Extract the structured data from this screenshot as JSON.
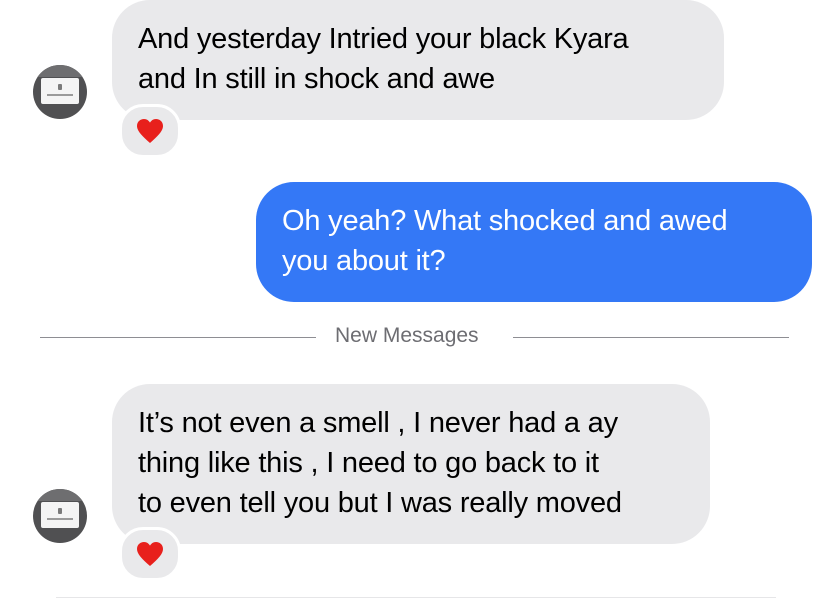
{
  "conversation": {
    "messages": [
      {
        "direction": "incoming",
        "lines": [
          "And yesterday Intried your black Kyara",
          "and In still in shock and awe"
        ],
        "reaction": "heart-icon"
      },
      {
        "direction": "outgoing",
        "lines": [
          "Oh yeah? What shocked and awed",
          "you about it?"
        ]
      },
      {
        "direction": "incoming",
        "lines": [
          "It’s not even a smell , I never had a ay",
          "thing like this , I need to go back to it",
          "to even tell you but I was really moved"
        ],
        "reaction": "heart-icon"
      }
    ],
    "divider": {
      "label": "New Messages"
    }
  },
  "colors": {
    "incoming_bubble": "#e9e9eb",
    "outgoing_bubble": "#3478f6",
    "reaction_heart": "#e8201c",
    "divider_text": "#6d6d72"
  }
}
